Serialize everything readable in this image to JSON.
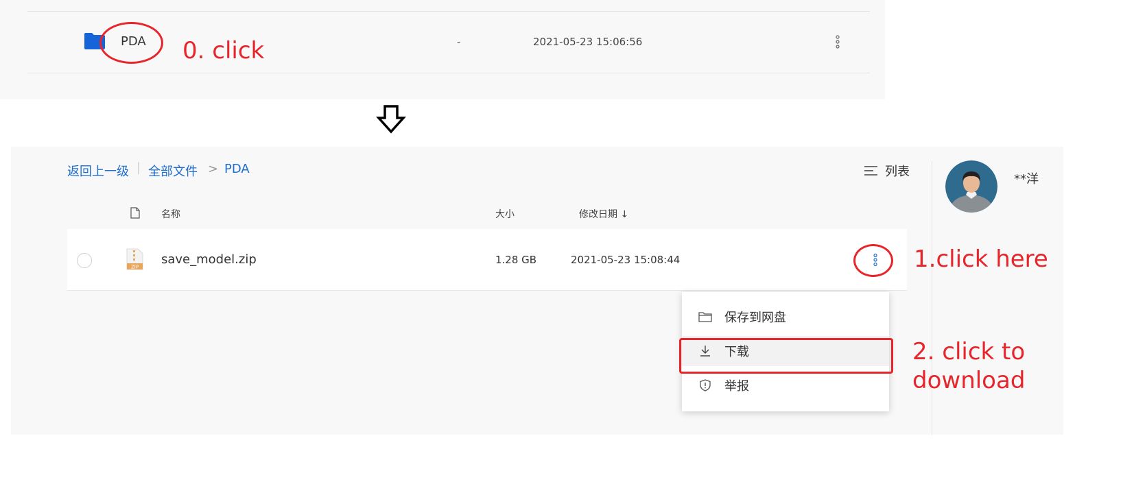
{
  "top": {
    "folder_name": "PDA",
    "size": "-",
    "modified": "2021-05-23 15:06:56"
  },
  "annotations": {
    "step0": "0. click",
    "step1": "1.click here",
    "step2_line1": "2. click to",
    "step2_line2": "download"
  },
  "breadcrumb": {
    "back": "返回上一级",
    "separator": "|",
    "all_files": "全部文件",
    "chevron": ">",
    "current": "PDA"
  },
  "view": {
    "label": "列表"
  },
  "user": {
    "name": "**洋"
  },
  "table": {
    "headers": {
      "name": "名称",
      "size": "大小",
      "modified": "修改日期 ↓"
    },
    "rows": [
      {
        "name": "save_model.zip",
        "size": "1.28 GB",
        "modified": "2021-05-23 15:08:44",
        "icon_label": "ZIP"
      }
    ]
  },
  "context_menu": {
    "items": [
      {
        "label": "保存到网盘",
        "icon": "folder-icon"
      },
      {
        "label": "下载",
        "icon": "download-icon"
      },
      {
        "label": "举报",
        "icon": "report-icon"
      }
    ]
  },
  "colors": {
    "accent": "#1f6fd1",
    "annotation_red": "#e8252b",
    "panel_bg": "#f8f8f8",
    "folder_blue": "#1565d8",
    "zip_orange": "#e8a65a"
  }
}
